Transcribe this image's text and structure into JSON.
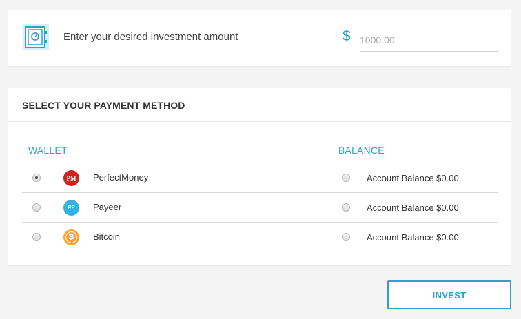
{
  "investment": {
    "label": "Enter your desired investment amount",
    "currency_symbol": "$",
    "amount_placeholder": "1000.00",
    "amount_value": ""
  },
  "payment": {
    "header": "SELECT YOUR PAYMENT METHOD",
    "wallet_heading": "WALLET",
    "balance_heading": "BALANCE",
    "rows": [
      {
        "wallet_name": "PerfectMoney",
        "logo_text": "PM",
        "logo_icon": "perfectmoney-logo",
        "wallet_selected": true,
        "balance_label": "Account Balance $0.00",
        "balance_selected": false
      },
      {
        "wallet_name": "Payeer",
        "logo_text": "PE",
        "logo_icon": "payeer-logo",
        "wallet_selected": false,
        "balance_label": "Account Balance $0.00",
        "balance_selected": false
      },
      {
        "wallet_name": "Bitcoin",
        "logo_text": "₿",
        "logo_icon": "bitcoin-logo",
        "wallet_selected": false,
        "balance_label": "Account Balance $0.00",
        "balance_selected": false
      }
    ]
  },
  "actions": {
    "invest_label": "INVEST"
  },
  "colors": {
    "accent": "#2aa3c7",
    "perfectmoney": "#d61f1f",
    "payeer": "#2eb3e3",
    "bitcoin": "#f7a627",
    "background": "#f4f4f4"
  }
}
